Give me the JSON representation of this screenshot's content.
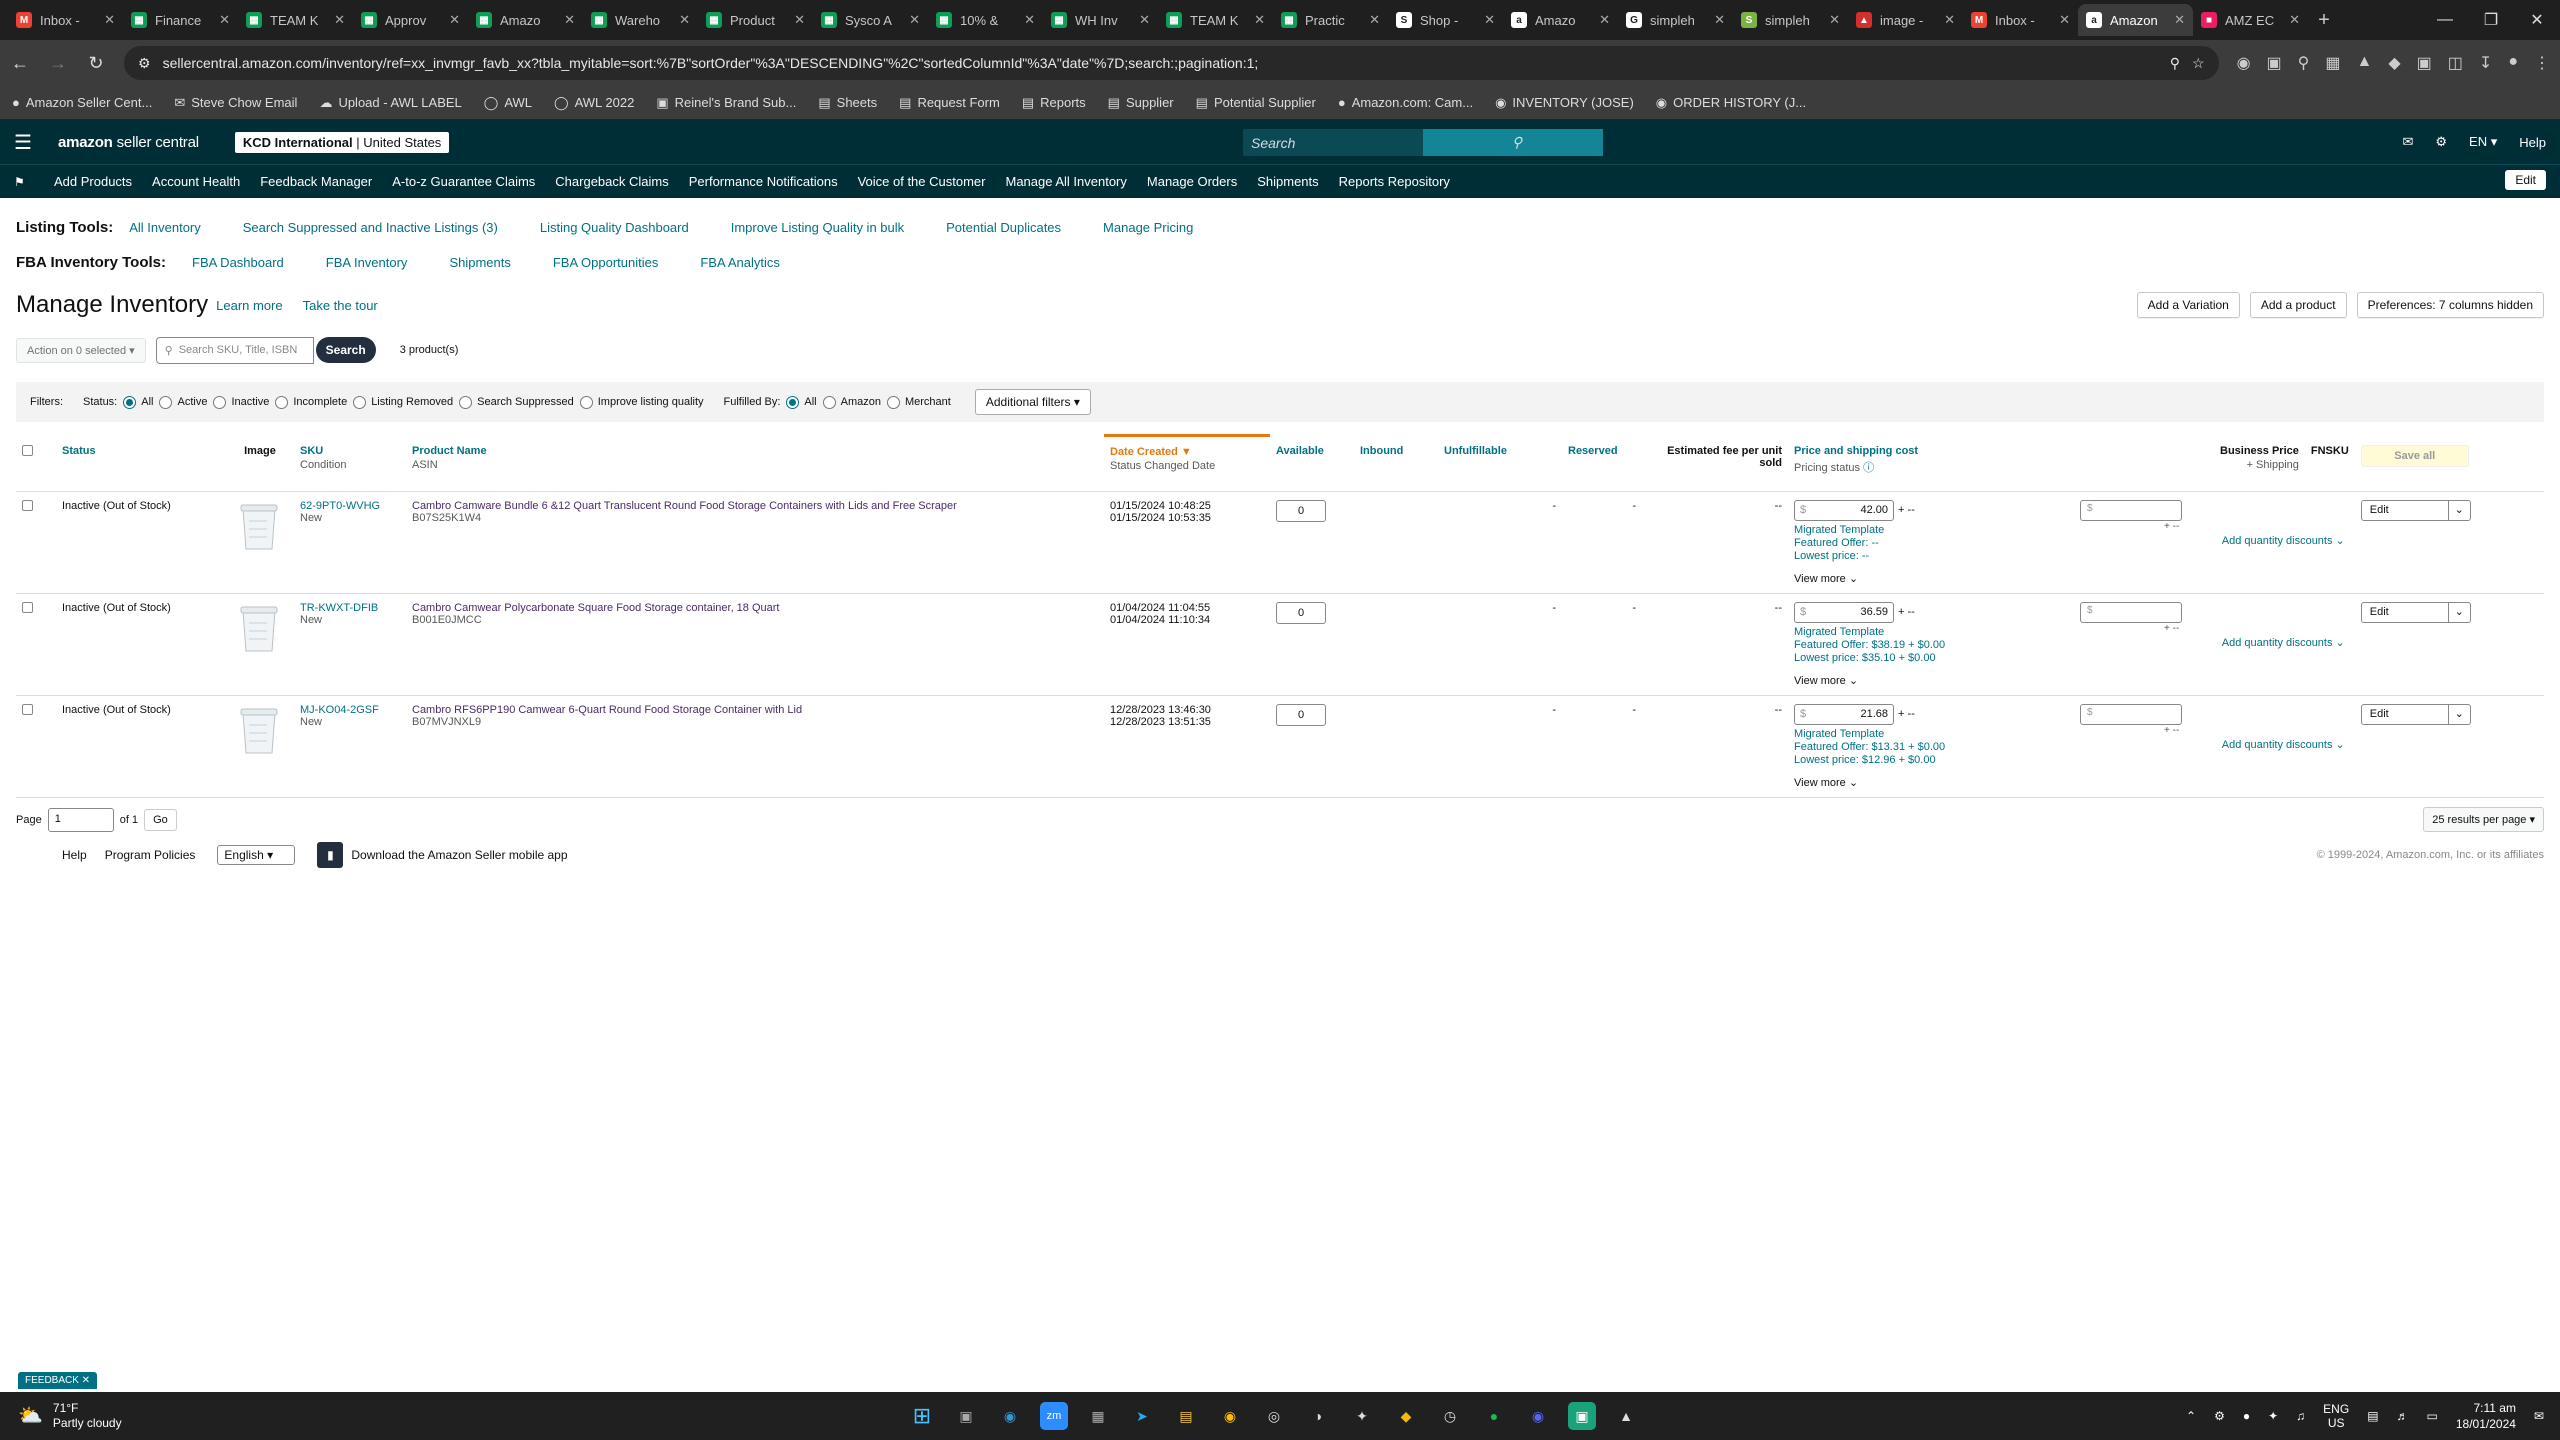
{
  "browser": {
    "tabs": [
      {
        "title": "Inbox -",
        "icon": "gmail",
        "color": "#ea4335"
      },
      {
        "title": "Finance",
        "icon": "sheets",
        "color": "#0f9d58"
      },
      {
        "title": "TEAM K",
        "icon": "sheets",
        "color": "#0f9d58"
      },
      {
        "title": "Approv",
        "icon": "sheets",
        "color": "#0f9d58"
      },
      {
        "title": "Amazo",
        "icon": "sheets",
        "color": "#0f9d58"
      },
      {
        "title": "Wareho",
        "icon": "sheets",
        "color": "#0f9d58"
      },
      {
        "title": "Product",
        "icon": "sheets",
        "color": "#0f9d58"
      },
      {
        "title": "Sysco A",
        "icon": "sheets",
        "color": "#0f9d58"
      },
      {
        "title": "10% &",
        "icon": "sheets",
        "color": "#0f9d58"
      },
      {
        "title": "WH Inv",
        "icon": "sheets",
        "color": "#0f9d58"
      },
      {
        "title": "TEAM K",
        "icon": "sheets",
        "color": "#0f9d58"
      },
      {
        "title": "Practic",
        "icon": "sheets",
        "color": "#0f9d58"
      },
      {
        "title": "Shop -",
        "icon": "shop",
        "color": "#ffffff"
      },
      {
        "title": "Amazo",
        "icon": "amazon",
        "color": "#ffffff"
      },
      {
        "title": "simpleh",
        "icon": "google",
        "color": "#ffffff"
      },
      {
        "title": "simpleh",
        "icon": "simple",
        "color": "#7cb342"
      },
      {
        "title": "image -",
        "icon": "image",
        "color": "#d32f2f"
      },
      {
        "title": "Inbox -",
        "icon": "gmail",
        "color": "#ea4335"
      },
      {
        "title": "Amazon",
        "icon": "amazon",
        "color": "#ffffff"
      },
      {
        "title": "AMZ EC",
        "icon": "amz",
        "color": "#e91e63"
      }
    ],
    "active_tab_index": 18,
    "url": "sellercentral.amazon.com/inventory/ref=xx_invmgr_favb_xx?tbla_myitable=sort:%7B\"sortOrder\"%3A\"DESCENDING\"%2C\"sortedColumnId\"%3A\"date\"%7D;search:;pagination:1;",
    "bookmarks": [
      "Amazon Seller Cent...",
      "Steve Chow Email",
      "Upload - AWL LABEL",
      "AWL",
      "AWL 2022",
      "Reinel's Brand Sub...",
      "Sheets",
      "Request Form",
      "Reports",
      "Supplier",
      "Potential Supplier",
      "Amazon.com: Cam...",
      "INVENTORY (JOSE)",
      "ORDER HISTORY (J..."
    ]
  },
  "seller": {
    "logo_main": "amazon",
    "logo_sub": "seller central",
    "account_bold": "KCD International",
    "account_region": "United States",
    "search_placeholder": "Search",
    "lang": "EN",
    "help": "Help",
    "nav": [
      "Add Products",
      "Account Health",
      "Feedback Manager",
      "A-to-z Guarantee Claims",
      "Chargeback Claims",
      "Performance Notifications",
      "Voice of the Customer",
      "Manage All Inventory",
      "Manage Orders",
      "Shipments",
      "Reports Repository"
    ],
    "nav_edit": "Edit"
  },
  "tools": {
    "listing_label": "Listing Tools:",
    "listing": [
      "All Inventory",
      "Search Suppressed and Inactive Listings (3)",
      "Listing Quality Dashboard",
      "Improve Listing Quality in bulk",
      "Potential Duplicates",
      "Manage Pricing"
    ],
    "fba_label": "FBA Inventory Tools:",
    "fba": [
      "FBA Dashboard",
      "FBA Inventory",
      "Shipments",
      "FBA Opportunities",
      "FBA Analytics"
    ]
  },
  "page": {
    "title": "Manage Inventory",
    "learn_more": "Learn more",
    "take_tour": "Take the tour",
    "add_variation": "Add a Variation",
    "add_product": "Add a product",
    "preferences": "Preferences: 7 columns hidden",
    "action_select": "Action on 0 selected",
    "search_placeholder": "Search SKU, Title, ISBN",
    "search_btn": "Search",
    "count": "3 product(s)"
  },
  "filters": {
    "label": "Filters:",
    "status_label": "Status:",
    "status_options": [
      "All",
      "Active",
      "Inactive",
      "Incomplete",
      "Listing Removed",
      "Search Suppressed",
      "Improve listing quality"
    ],
    "status_selected": "All",
    "fulfilled_label": "Fulfilled By:",
    "fulfilled_options": [
      "All",
      "Amazon",
      "Merchant"
    ],
    "fulfilled_selected": "All",
    "additional": "Additional filters"
  },
  "table": {
    "headers": {
      "status": "Status",
      "image": "Image",
      "sku": "SKU",
      "sku_sub": "Condition",
      "product": "Product Name",
      "product_sub": "ASIN",
      "date": "Date Created",
      "date_sub": "Status Changed Date",
      "available": "Available",
      "inbound": "Inbound",
      "unfulfillable": "Unfulfillable",
      "reserved": "Reserved",
      "fee": "Estimated fee per unit sold",
      "price": "Price and shipping cost",
      "price_sub": "Pricing status",
      "business": "Business Price",
      "business_sub": "+ Shipping",
      "fnsku": "FNSKU",
      "save_all": "Save all"
    },
    "rows": [
      {
        "status": "Inactive (Out of Stock)",
        "sku": "62-9PT0-WVHG",
        "condition": "New",
        "name": "Cambro Camware Bundle 6 &12 Quart Translucent Round Food Storage Containers with Lids and Free Scraper",
        "asin": "B07S25K1W4",
        "created": "01/15/2024 10:48:25",
        "changed": "01/15/2024 10:53:35",
        "available": "0",
        "unfulfillable": "-",
        "reserved": "-",
        "fee": "--",
        "price": "42.00",
        "template": "Migrated Template",
        "featured": "Featured Offer: --",
        "lowest": "Lowest price: --",
        "view_more": "View more",
        "add_qty": "Add quantity discounts",
        "edit": "Edit"
      },
      {
        "status": "Inactive (Out of Stock)",
        "sku": "TR-KWXT-DFIB",
        "condition": "New",
        "name": "Cambro Camwear Polycarbonate Square Food Storage container, 18 Quart",
        "asin": "B001E0JMCC",
        "created": "01/04/2024 11:04:55",
        "changed": "01/04/2024 11:10:34",
        "available": "0",
        "unfulfillable": "-",
        "reserved": "-",
        "fee": "--",
        "price": "36.59",
        "template": "Migrated Template",
        "featured": "Featured Offer: $38.19 + $0.00",
        "lowest": "Lowest price: $35.10 + $0.00",
        "view_more": "View more",
        "add_qty": "Add quantity discounts",
        "edit": "Edit"
      },
      {
        "status": "Inactive (Out of Stock)",
        "sku": "MJ-KO04-2GSF",
        "condition": "New",
        "name": "Cambro RFS6PP190 Camwear 6-Quart Round Food Storage Container with Lid",
        "asin": "B07MVJNXL9",
        "created": "12/28/2023 13:46:30",
        "changed": "12/28/2023 13:51:35",
        "available": "0",
        "unfulfillable": "-",
        "reserved": "-",
        "fee": "--",
        "price": "21.68",
        "template": "Migrated Template",
        "featured": "Featured Offer: $13.31 + $0.00",
        "lowest": "Lowest price: $12.96 + $0.00",
        "view_more": "View more",
        "add_qty": "Add quantity discounts",
        "edit": "Edit"
      }
    ]
  },
  "pager": {
    "label": "Page",
    "value": "1",
    "of": "of 1",
    "go": "Go",
    "per_page": "25 results per page"
  },
  "footer": {
    "help": "Help",
    "policies": "Program Policies",
    "lang": "English",
    "app": "Download the Amazon Seller mobile app",
    "copy": "© 1999-2024, Amazon.com, Inc. or its affiliates"
  },
  "feedback": "FEEDBACK",
  "taskbar": {
    "temp": "71°F",
    "weather": "Partly cloudy",
    "lang1": "ENG",
    "lang2": "US",
    "time": "7:11 am",
    "date": "18/01/2024"
  }
}
